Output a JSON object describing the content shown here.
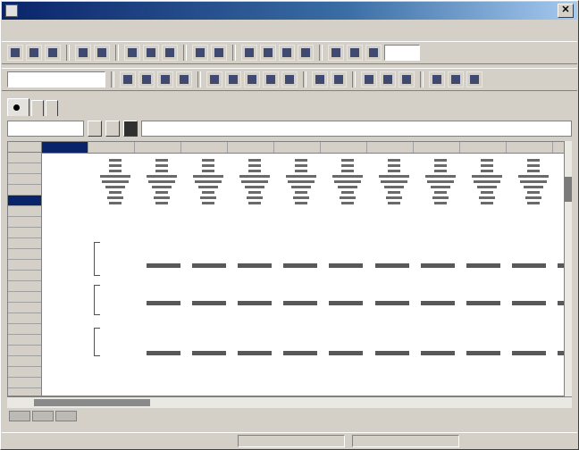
{
  "window": {
    "title": ""
  },
  "menu": {
    "items": [
      "",
      "",
      "",
      "",
      "",
      "",
      "",
      "",
      "",
      ""
    ]
  },
  "toolbar": {
    "field_value": ""
  },
  "tabs": [
    {
      "label": ""
    },
    {
      "label": ""
    },
    {
      "label": ""
    }
  ],
  "formula_bar": {
    "name_box": "",
    "formula": ""
  },
  "grid": {
    "column_headers": [
      "",
      "",
      "",
      "",
      "",
      "",
      "",
      "",
      "",
      "",
      ""
    ],
    "row_headers": [
      "",
      "",
      "",
      "",
      "",
      "",
      "",
      "",
      "",
      "",
      "",
      "",
      "",
      "",
      "",
      "",
      "",
      "",
      "",
      "",
      "",
      "",
      ""
    ],
    "series_labels": [
      "",
      "",
      ""
    ]
  },
  "status": {
    "left": "",
    "middle": "",
    "right": ""
  }
}
